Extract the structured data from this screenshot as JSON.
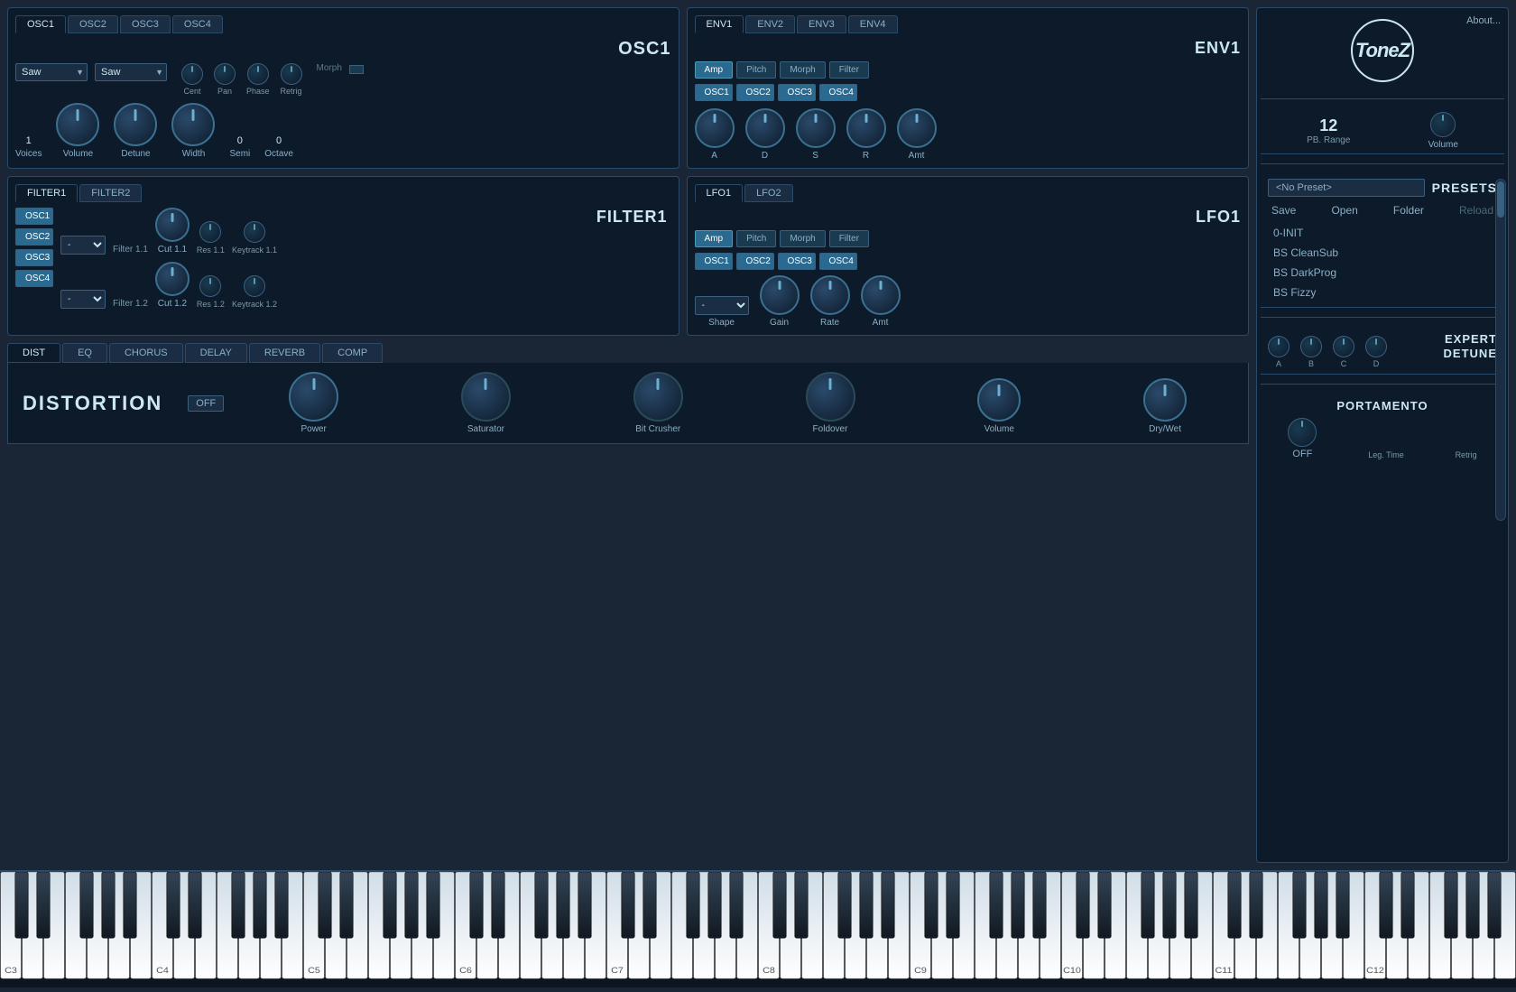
{
  "app": {
    "title": "ToneZ",
    "about_label": "About..."
  },
  "osc_tabs": [
    "OSC1",
    "OSC2",
    "OSC3",
    "OSC4"
  ],
  "osc1": {
    "title": "OSC1",
    "waveform1": "Saw",
    "waveform2": "Saw",
    "morph_label": "Morph",
    "voices_label": "Voices",
    "voices_value": "1",
    "volume_label": "Volume",
    "detune_label": "Detune",
    "width_label": "Width",
    "semi_label": "Semi",
    "semi_value": "0",
    "octave_label": "Octave",
    "octave_value": "0",
    "cent_label": "Cent",
    "pan_label": "Pan",
    "phase_label": "Phase",
    "retrig_label": "Retrig"
  },
  "env_tabs": [
    "ENV1",
    "ENV2",
    "ENV3",
    "ENV4"
  ],
  "env1": {
    "title": "ENV1",
    "targets": [
      "Amp",
      "Pitch",
      "Morph",
      "Filter"
    ],
    "active_target": "Amp",
    "sources": [
      "OSC1",
      "OSC2",
      "OSC3",
      "OSC4"
    ],
    "a_label": "A",
    "d_label": "D",
    "s_label": "S",
    "r_label": "R",
    "amt_label": "Amt"
  },
  "filter_tabs": [
    "FILTER1",
    "FILTER2"
  ],
  "filter1": {
    "title": "FILTER1",
    "sources": [
      "OSC1",
      "OSC2",
      "OSC3",
      "OSC4"
    ],
    "filter1_label": "Filter 1.1",
    "filter2_label": "Filter 1.2",
    "cut1_label": "Cut 1.1",
    "cut2_label": "Cut 1.2",
    "res1_label": "Res 1.1",
    "res2_label": "Res 1.2",
    "keytrack1_label": "Keytrack 1.1",
    "keytrack2_label": "Keytrack 1.2"
  },
  "lfo_tabs": [
    "LFO1",
    "LFO2"
  ],
  "lfo1": {
    "title": "LFO1",
    "targets": [
      "Amp",
      "Pitch",
      "Morph",
      "Filter"
    ],
    "active_target": "Amp",
    "sources": [
      "OSC1",
      "OSC2",
      "OSC3",
      "OSC4"
    ],
    "shape_label": "Shape",
    "gain_label": "Gain",
    "rate_label": "Rate",
    "amt_label": "Amt"
  },
  "effects": {
    "tabs": [
      "DIST",
      "EQ",
      "CHORUS",
      "DELAY",
      "REVERB",
      "COMP"
    ],
    "active_tab": "DIST",
    "title": "DISTORTION",
    "status": "OFF",
    "knobs": [
      {
        "label": "Power",
        "id": "power"
      },
      {
        "label": "Saturator",
        "id": "saturator"
      },
      {
        "label": "Bit Crusher",
        "id": "bit-crusher"
      },
      {
        "label": "Foldover",
        "id": "foldover"
      },
      {
        "label": "Volume",
        "id": "volume"
      },
      {
        "label": "Dry/Wet",
        "id": "dry-wet"
      }
    ]
  },
  "right_panel": {
    "pb_range_label": "PB. Range",
    "pb_range_value": "12",
    "volume_label": "Volume",
    "presets_label": "PRESETS",
    "preset_name": "<No Preset>",
    "save_label": "Save",
    "open_label": "Open",
    "folder_label": "Folder",
    "reload_label": "Reload",
    "preset_list": [
      "0-INIT",
      "BS CleanSub",
      "BS DarkProg",
      "BS Fizzy"
    ],
    "expert_title": "EXPERT\nDETUNE",
    "expert_knobs": [
      "A",
      "B",
      "C",
      "D"
    ],
    "portamento_title": "PORTAMENTO",
    "portamento_status": "OFF",
    "leg_time_label": "Leg. Time",
    "retrig_label": "Retrig"
  },
  "keyboard": {
    "labels": [
      "C5",
      "C6",
      "C7",
      "C8",
      "C9",
      "C10"
    ]
  }
}
